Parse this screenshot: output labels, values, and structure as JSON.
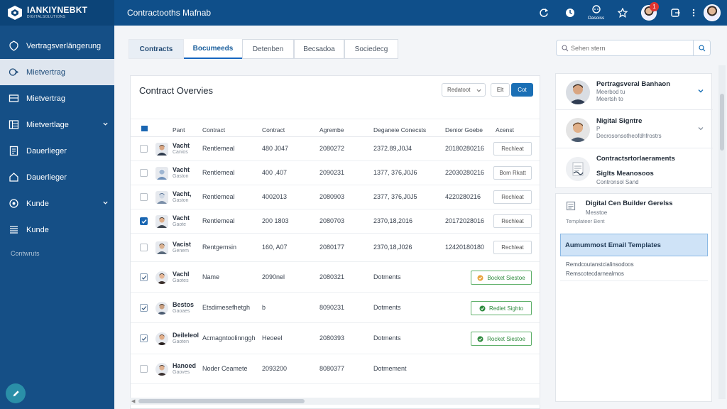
{
  "app": {
    "logo_text": "IANKIYNEBKT",
    "logo_sub": "DIGITALSOLUTIONS",
    "title": "Contractooths Mafnab"
  },
  "topbar": {
    "icons": [
      {
        "name": "refresh-icon",
        "caption": ""
      },
      {
        "name": "clock-icon",
        "caption": ""
      },
      {
        "name": "support-icon",
        "caption": "Oasoiss"
      },
      {
        "name": "star-icon",
        "caption": ""
      }
    ],
    "notification_count": "1"
  },
  "sidebar": {
    "items": [
      {
        "label": "Vertragsverlängerung",
        "icon": "shield-icon"
      },
      {
        "label": "Mietvertrag",
        "icon": "contract-icon",
        "active": true
      },
      {
        "label": "Mietvertrag",
        "icon": "card-icon"
      },
      {
        "label": "Mietvertlage",
        "icon": "table-icon"
      },
      {
        "label": "Dauerlieger",
        "icon": "document-icon"
      },
      {
        "label": "Dauerlieger",
        "icon": "home-icon"
      },
      {
        "label": "Kunde",
        "icon": "globe-icon"
      },
      {
        "label": "Kunde",
        "icon": "list-icon"
      }
    ],
    "section_label": "Contwruts"
  },
  "tabs": [
    "Contracts",
    "Bocumeeds",
    "Detenben",
    "Becsadoa",
    "Sociedecg"
  ],
  "search": {
    "placeholder": "Sehen stern"
  },
  "card": {
    "title": "Contract Overvies",
    "filter_label": "Redatoot",
    "btn_edit": "Elt",
    "btn_primary": "Cot"
  },
  "table": {
    "headers": [
      "Pant",
      "Contract",
      "Contract",
      "Agrembe",
      "Deganeie Conecsts",
      "Denior Goebe",
      "Acenst"
    ],
    "rows": [
      {
        "name": "Vacht",
        "sub": "Canios",
        "type": "Rentlemeal",
        "contract": "480 J047",
        "agreement": "2080272",
        "date1": "2372.89,J0J4",
        "date2": "20180280216",
        "action": "Rechleat",
        "action_kind": "plain",
        "check": "off"
      },
      {
        "name": "Vacht",
        "sub": "Gaston",
        "type": "Rentlemeal",
        "contract": "400 ,407",
        "agreement": "2090231",
        "date1": "1377, 376,J0J6",
        "date2": "22030280216",
        "action": "Bom Rkatt",
        "action_kind": "plain",
        "check": "off"
      },
      {
        "name": "Vacht,",
        "sub": "Gaston",
        "type": "Rentlemeal",
        "contract": "4002013",
        "agreement": "2080903",
        "date1": "2377, 376,J0J5",
        "date2": "4220280216",
        "action": "Rechleat",
        "action_kind": "plain",
        "check": "off"
      },
      {
        "name": "Vacht",
        "sub": "Gaote",
        "type": "Rentlemeal",
        "contract": "200 1803",
        "agreement": "2080703",
        "date1": "2370,18,2016",
        "date2": "20172028016",
        "action": "Rechleat",
        "action_kind": "plain",
        "check": "on"
      },
      {
        "name": "Vacist",
        "sub": "Genem",
        "type": "Rentgemsin",
        "contract": "160, A07",
        "agreement": "2080177",
        "date1": "2370,18,J026",
        "date2": "12420180180",
        "action": "Rechleat",
        "action_kind": "plain",
        "check": "off"
      },
      {
        "name": "Vachl",
        "sub": "Gaotes",
        "type": "Name",
        "contract": "2090nel",
        "agreement": "2080321",
        "date1": "Dotments",
        "date2": "",
        "action": "Bocket Siestoe",
        "action_kind": "green",
        "check": "tick"
      },
      {
        "name": "Bestos",
        "sub": "Gaoaes",
        "type": "Etsdimesefhetgh",
        "contract": "b",
        "agreement": "8090231",
        "date1": "Dotments",
        "date2": "",
        "action": "Rediet Sighto",
        "action_kind": "green",
        "check": "tick"
      },
      {
        "name": "Deileleol",
        "sub": "Gaoten",
        "type": "Acmagntoolinnggh",
        "contract": "Heoeel",
        "agreement": "2080393",
        "date1": "Dotments",
        "date2": "",
        "action": "Rocket Siestoe",
        "action_kind": "green",
        "check": "tick"
      },
      {
        "name": "Hanoed",
        "sub": "Gaoves",
        "type": "Noder Ceamete",
        "contract": "2093200",
        "agreement": "8080377",
        "date1": "Dotmement",
        "date2": "",
        "action": "",
        "action_kind": "none",
        "check": "off"
      }
    ]
  },
  "right_panel": {
    "contacts": [
      {
        "title": "Pertragsveral Banhaon",
        "sub1": "Meerbod tu",
        "sub2": "Meertsh to"
      },
      {
        "title": "Nigital Signtre",
        "sub1": "P",
        "sub2": "Decrosonsotheofdhfrostrs"
      },
      {
        "title": "Contractsrtorlaeraments",
        "sub1": "Siglts Meanosoos",
        "sub2": "Contronsol Sand"
      }
    ],
    "templates": {
      "title": "Digital Cen Builder Gerelss",
      "sub1": "Messtoe",
      "sub2": "Templateer Bent",
      "highlight": "Aumummost Email Templates",
      "line1": "Remdcoutanstcialinsodoos",
      "line2": "Remscotecdarnealmos"
    }
  }
}
